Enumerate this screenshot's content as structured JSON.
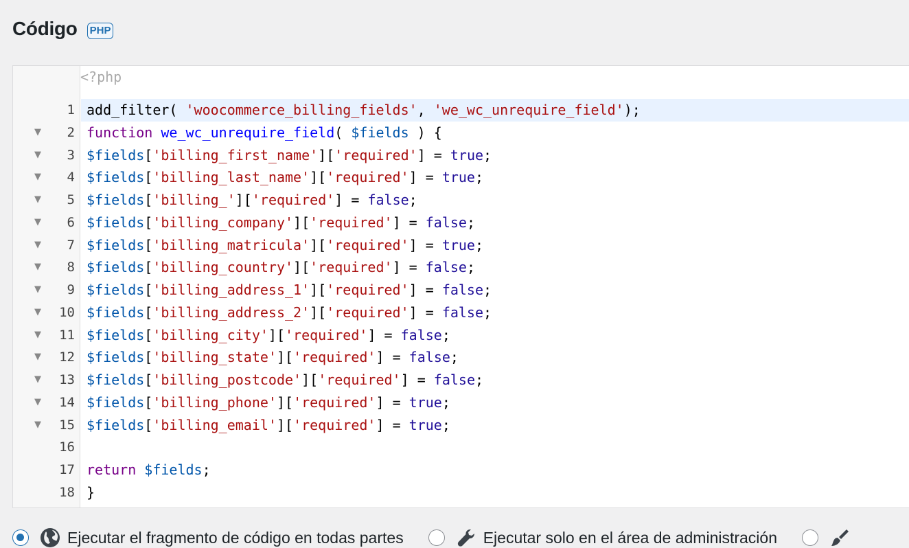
{
  "section": {
    "title": "Código",
    "language_badge": "PHP"
  },
  "editor": {
    "preamble": "<?php",
    "active_line": 1,
    "lines": [
      {
        "n": "1",
        "fold": false,
        "tokens": [
          {
            "t": "add_filter( ",
            "c": "plain"
          },
          {
            "t": "'woocommerce_billing_fields'",
            "c": "str"
          },
          {
            "t": ", ",
            "c": "plain"
          },
          {
            "t": "'we_wc_unrequire_field'",
            "c": "str"
          },
          {
            "t": ");",
            "c": "plain"
          }
        ]
      },
      {
        "n": "2",
        "fold": true,
        "tokens": [
          {
            "t": "function",
            "c": "kw"
          },
          {
            "t": " ",
            "c": "plain"
          },
          {
            "t": "we_wc_unrequire_field",
            "c": "def"
          },
          {
            "t": "( ",
            "c": "plain"
          },
          {
            "t": "$fields",
            "c": "var"
          },
          {
            "t": " ) {",
            "c": "plain"
          }
        ]
      },
      {
        "n": "3",
        "fold": true,
        "tokens": [
          {
            "t": "$fields",
            "c": "var"
          },
          {
            "t": "[",
            "c": "plain"
          },
          {
            "t": "'billing_first_name'",
            "c": "str"
          },
          {
            "t": "][",
            "c": "plain"
          },
          {
            "t": "'required'",
            "c": "str"
          },
          {
            "t": "] = ",
            "c": "plain"
          },
          {
            "t": "true",
            "c": "atom"
          },
          {
            "t": ";",
            "c": "plain"
          }
        ]
      },
      {
        "n": "4",
        "fold": true,
        "tokens": [
          {
            "t": "$fields",
            "c": "var"
          },
          {
            "t": "[",
            "c": "plain"
          },
          {
            "t": "'billing_last_name'",
            "c": "str"
          },
          {
            "t": "][",
            "c": "plain"
          },
          {
            "t": "'required'",
            "c": "str"
          },
          {
            "t": "] = ",
            "c": "plain"
          },
          {
            "t": "true",
            "c": "atom"
          },
          {
            "t": ";",
            "c": "plain"
          }
        ]
      },
      {
        "n": "5",
        "fold": true,
        "tokens": [
          {
            "t": "$fields",
            "c": "var"
          },
          {
            "t": "[",
            "c": "plain"
          },
          {
            "t": "'billing_'",
            "c": "str"
          },
          {
            "t": "][",
            "c": "plain"
          },
          {
            "t": "'required'",
            "c": "str"
          },
          {
            "t": "] = ",
            "c": "plain"
          },
          {
            "t": "false",
            "c": "atom"
          },
          {
            "t": ";",
            "c": "plain"
          }
        ]
      },
      {
        "n": "6",
        "fold": true,
        "tokens": [
          {
            "t": "$fields",
            "c": "var"
          },
          {
            "t": "[",
            "c": "plain"
          },
          {
            "t": "'billing_company'",
            "c": "str"
          },
          {
            "t": "][",
            "c": "plain"
          },
          {
            "t": "'required'",
            "c": "str"
          },
          {
            "t": "] = ",
            "c": "plain"
          },
          {
            "t": "false",
            "c": "atom"
          },
          {
            "t": ";",
            "c": "plain"
          }
        ]
      },
      {
        "n": "7",
        "fold": true,
        "tokens": [
          {
            "t": "$fields",
            "c": "var"
          },
          {
            "t": "[",
            "c": "plain"
          },
          {
            "t": "'billing_matricula'",
            "c": "str"
          },
          {
            "t": "][",
            "c": "plain"
          },
          {
            "t": "'required'",
            "c": "str"
          },
          {
            "t": "] = ",
            "c": "plain"
          },
          {
            "t": "true",
            "c": "atom"
          },
          {
            "t": ";",
            "c": "plain"
          }
        ]
      },
      {
        "n": "8",
        "fold": true,
        "tokens": [
          {
            "t": "$fields",
            "c": "var"
          },
          {
            "t": "[",
            "c": "plain"
          },
          {
            "t": "'billing_country'",
            "c": "str"
          },
          {
            "t": "][",
            "c": "plain"
          },
          {
            "t": "'required'",
            "c": "str"
          },
          {
            "t": "] = ",
            "c": "plain"
          },
          {
            "t": "false",
            "c": "atom"
          },
          {
            "t": ";",
            "c": "plain"
          }
        ]
      },
      {
        "n": "9",
        "fold": true,
        "tokens": [
          {
            "t": "$fields",
            "c": "var"
          },
          {
            "t": "[",
            "c": "plain"
          },
          {
            "t": "'billing_address_1'",
            "c": "str"
          },
          {
            "t": "][",
            "c": "plain"
          },
          {
            "t": "'required'",
            "c": "str"
          },
          {
            "t": "] = ",
            "c": "plain"
          },
          {
            "t": "false",
            "c": "atom"
          },
          {
            "t": ";",
            "c": "plain"
          }
        ]
      },
      {
        "n": "10",
        "fold": true,
        "tokens": [
          {
            "t": "$fields",
            "c": "var"
          },
          {
            "t": "[",
            "c": "plain"
          },
          {
            "t": "'billing_address_2'",
            "c": "str"
          },
          {
            "t": "][",
            "c": "plain"
          },
          {
            "t": "'required'",
            "c": "str"
          },
          {
            "t": "] = ",
            "c": "plain"
          },
          {
            "t": "false",
            "c": "atom"
          },
          {
            "t": ";",
            "c": "plain"
          }
        ]
      },
      {
        "n": "11",
        "fold": true,
        "tokens": [
          {
            "t": "$fields",
            "c": "var"
          },
          {
            "t": "[",
            "c": "plain"
          },
          {
            "t": "'billing_city'",
            "c": "str"
          },
          {
            "t": "][",
            "c": "plain"
          },
          {
            "t": "'required'",
            "c": "str"
          },
          {
            "t": "] = ",
            "c": "plain"
          },
          {
            "t": "false",
            "c": "atom"
          },
          {
            "t": ";",
            "c": "plain"
          }
        ]
      },
      {
        "n": "12",
        "fold": true,
        "tokens": [
          {
            "t": "$fields",
            "c": "var"
          },
          {
            "t": "[",
            "c": "plain"
          },
          {
            "t": "'billing_state'",
            "c": "str"
          },
          {
            "t": "][",
            "c": "plain"
          },
          {
            "t": "'required'",
            "c": "str"
          },
          {
            "t": "] = ",
            "c": "plain"
          },
          {
            "t": "false",
            "c": "atom"
          },
          {
            "t": ";",
            "c": "plain"
          }
        ]
      },
      {
        "n": "13",
        "fold": true,
        "tokens": [
          {
            "t": "$fields",
            "c": "var"
          },
          {
            "t": "[",
            "c": "plain"
          },
          {
            "t": "'billing_postcode'",
            "c": "str"
          },
          {
            "t": "][",
            "c": "plain"
          },
          {
            "t": "'required'",
            "c": "str"
          },
          {
            "t": "] = ",
            "c": "plain"
          },
          {
            "t": "false",
            "c": "atom"
          },
          {
            "t": ";",
            "c": "plain"
          }
        ]
      },
      {
        "n": "14",
        "fold": true,
        "tokens": [
          {
            "t": "$fields",
            "c": "var"
          },
          {
            "t": "[",
            "c": "plain"
          },
          {
            "t": "'billing_phone'",
            "c": "str"
          },
          {
            "t": "][",
            "c": "plain"
          },
          {
            "t": "'required'",
            "c": "str"
          },
          {
            "t": "] = ",
            "c": "plain"
          },
          {
            "t": "true",
            "c": "atom"
          },
          {
            "t": ";",
            "c": "plain"
          }
        ]
      },
      {
        "n": "15",
        "fold": true,
        "tokens": [
          {
            "t": "$fields",
            "c": "var"
          },
          {
            "t": "[",
            "c": "plain"
          },
          {
            "t": "'billing_email'",
            "c": "str"
          },
          {
            "t": "][",
            "c": "plain"
          },
          {
            "t": "'required'",
            "c": "str"
          },
          {
            "t": "] = ",
            "c": "plain"
          },
          {
            "t": "true",
            "c": "atom"
          },
          {
            "t": ";",
            "c": "plain"
          }
        ]
      },
      {
        "n": "16",
        "fold": false,
        "tokens": []
      },
      {
        "n": "17",
        "fold": false,
        "tokens": [
          {
            "t": "return",
            "c": "kw"
          },
          {
            "t": " ",
            "c": "plain"
          },
          {
            "t": "$fields",
            "c": "var"
          },
          {
            "t": ";",
            "c": "plain"
          }
        ]
      },
      {
        "n": "18",
        "fold": false,
        "tokens": [
          {
            "t": "}",
            "c": "plain"
          }
        ]
      }
    ]
  },
  "scope_options": [
    {
      "label": "Ejecutar el fragmento de código en todas partes",
      "icon": "globe-icon",
      "checked": true
    },
    {
      "label": "Ejecutar solo en el área de administración",
      "icon": "wrench-icon",
      "checked": false
    },
    {
      "label": "",
      "icon": "brush-icon",
      "checked": false
    }
  ],
  "colors": {
    "accent": "#2271b1",
    "string": "#aa1111",
    "keyword": "#770088",
    "definition": "#0000ff",
    "variable": "#0055aa",
    "atom": "#221199",
    "active_line": "#e8f2ff"
  }
}
